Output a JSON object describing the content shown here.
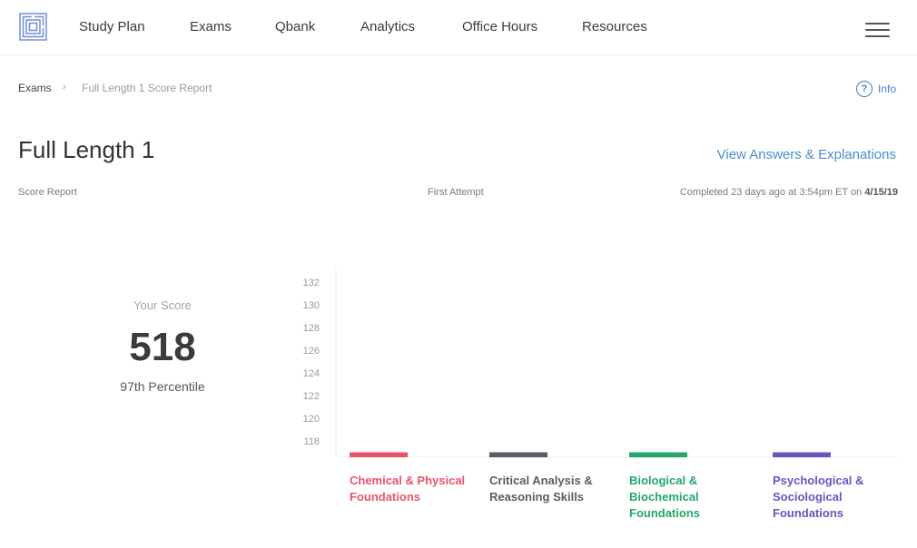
{
  "nav": {
    "logo_icon": "maze-logo-icon",
    "items": [
      {
        "label": "Study Plan"
      },
      {
        "label": "Exams"
      },
      {
        "label": "Qbank"
      },
      {
        "label": "Analytics"
      },
      {
        "label": "Office Hours"
      },
      {
        "label": "Resources"
      }
    ],
    "menu_icon": "hamburger-menu-icon"
  },
  "breadcrumb": {
    "root": "Exams",
    "separator": "›",
    "current": "Full Length 1 Score Report"
  },
  "info": {
    "icon": "question-circle-icon",
    "label": "Info"
  },
  "page": {
    "title": "Full Length 1",
    "view_answers": "View Answers & Explanations"
  },
  "meta": {
    "left": "Score Report",
    "center": "First Attempt",
    "right_prefix": "Completed 23 days ago at 3:54pm ET on ",
    "right_date": "4/15/19"
  },
  "score": {
    "caption": "Your Score",
    "value": "518",
    "percentile": "97th Percentile"
  },
  "colors": {
    "accent_blue": "#3f7fc4",
    "chem": "#e8546c",
    "cars": "#5b5b66",
    "bio": "#22a86b",
    "psych": "#6b55c2"
  },
  "chart_data": {
    "type": "bar",
    "ylim": [
      117,
      133
    ],
    "yticks": [
      118,
      120,
      122,
      124,
      126,
      128,
      130,
      132
    ],
    "categories": [
      "Chemical & Physical Foundations",
      "Critical Analysis & Reasoning Skills",
      "Biological & Biochemical Foundations",
      "Psychological & Sociological Foundations"
    ],
    "category_lines": [
      [
        "Chemical & Physical",
        "Foundations"
      ],
      [
        "Critical Analysis &",
        "Reasoning Skills"
      ],
      [
        "Biological &",
        "Biochemical",
        "Foundations"
      ],
      [
        "Psychological &",
        "Sociological",
        "Foundations"
      ]
    ],
    "colors": [
      "#e8546c",
      "#5b5b66",
      "#22a86b",
      "#6b55c2"
    ],
    "values": [
      117,
      117,
      117,
      117
    ],
    "grid": false,
    "legend": "none"
  }
}
